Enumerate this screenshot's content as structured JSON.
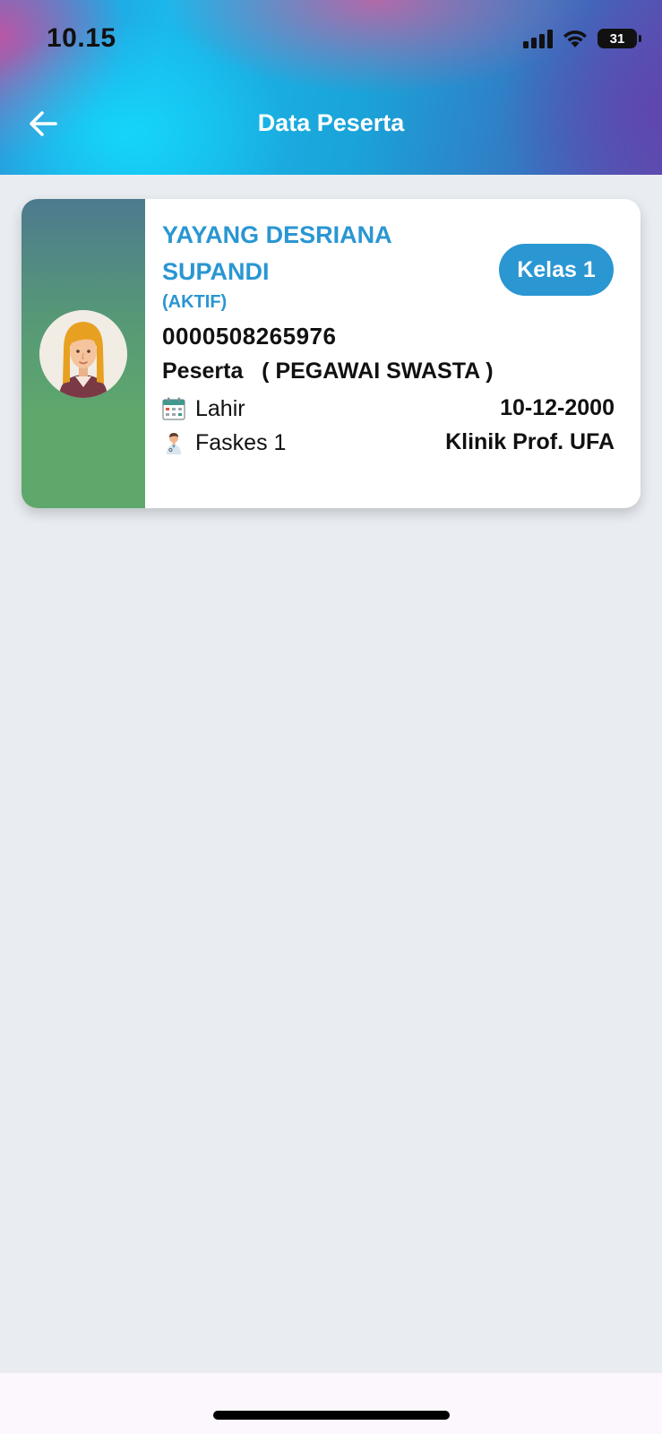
{
  "status_bar": {
    "time": "10.15",
    "battery_level": "31",
    "icons": [
      "signal-icon",
      "wifi-icon",
      "battery-icon"
    ]
  },
  "header": {
    "title": "Data Peserta",
    "back_icon": "arrow-left-icon"
  },
  "card": {
    "name": "YAYANG DESRIANA SUPANDI",
    "status": "(AKTIF)",
    "class_badge": "Kelas 1",
    "card_number": "0000508265976",
    "member_type": "Peserta   ( PEGAWAI SWASTA )",
    "birth": {
      "icon": "calendar-icon",
      "label": "Lahir",
      "value": "10-12-2000"
    },
    "faskes": {
      "icon": "doctor-icon",
      "label": "Faskes 1",
      "value": "Klinik Prof. UFA"
    }
  },
  "colors": {
    "accent": "#2a96d2",
    "card_side_top": "#4d7a8f",
    "card_side_bottom": "#5ea86c",
    "page_background": "#e9edf1"
  }
}
